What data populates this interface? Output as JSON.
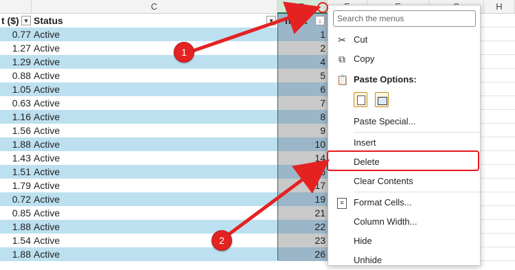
{
  "columns": {
    "A_partial": "",
    "C": "C",
    "D": "D",
    "E": "E",
    "F": "F",
    "G": "G",
    "H": "H"
  },
  "headers": {
    "price": "t ($)",
    "status": "Status",
    "index": "ndex"
  },
  "rows": [
    {
      "price": "0.77",
      "status": "Active",
      "index": "1"
    },
    {
      "price": "1.27",
      "status": "Active",
      "index": "2"
    },
    {
      "price": "1.29",
      "status": "Active",
      "index": "4"
    },
    {
      "price": "0.88",
      "status": "Active",
      "index": "5"
    },
    {
      "price": "1.05",
      "status": "Active",
      "index": "6"
    },
    {
      "price": "0.63",
      "status": "Active",
      "index": "7"
    },
    {
      "price": "1.16",
      "status": "Active",
      "index": "8"
    },
    {
      "price": "1.56",
      "status": "Active",
      "index": "9"
    },
    {
      "price": "1.88",
      "status": "Active",
      "index": "10"
    },
    {
      "price": "1.43",
      "status": "Active",
      "index": "14"
    },
    {
      "price": "1.51",
      "status": "Active",
      "index": "16"
    },
    {
      "price": "1.79",
      "status": "Active",
      "index": "17"
    },
    {
      "price": "0.72",
      "status": "Active",
      "index": "19"
    },
    {
      "price": "0.85",
      "status": "Active",
      "index": "21"
    },
    {
      "price": "1.88",
      "status": "Active",
      "index": "22"
    },
    {
      "price": "1.54",
      "status": "Active",
      "index": "23"
    },
    {
      "price": "1.88",
      "status": "Active",
      "index": "26"
    }
  ],
  "menu": {
    "search_placeholder": "Search the menus",
    "cut": "Cut",
    "copy": "Copy",
    "paste_options": "Paste Options:",
    "paste_special": "Paste Special...",
    "insert": "Insert",
    "delete": "Delete",
    "clear_contents": "Clear Contents",
    "format_cells": "Format Cells...",
    "column_width": "Column Width...",
    "hide": "Hide",
    "unhide": "Unhide"
  },
  "annotations": {
    "step1": "1",
    "step2": "2"
  },
  "colors": {
    "band_light": "#bde0f0",
    "band_dark_index": "#9ab6c8",
    "index_light": "#c9c9c9",
    "accent_red": "#e42222",
    "excel_green": "#217346"
  }
}
